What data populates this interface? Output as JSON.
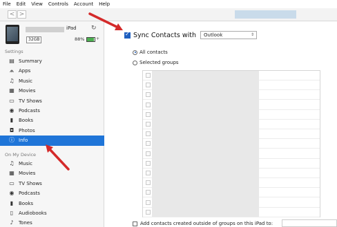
{
  "menu": [
    "File",
    "Edit",
    "View",
    "Controls",
    "Account",
    "Help"
  ],
  "toolbar": {
    "back": "<",
    "forward": ">"
  },
  "device": {
    "name": "iPad",
    "capacity": "32GB",
    "battery": "88%",
    "battery_level": 0.88
  },
  "sidebar": {
    "settings_header": "Settings",
    "settings_items": [
      {
        "label": "Summary",
        "icon": "summary-icon",
        "glyph": "▤"
      },
      {
        "label": "Apps",
        "icon": "apps-icon",
        "glyph": "⩕"
      },
      {
        "label": "Music",
        "icon": "music-icon",
        "glyph": "♫"
      },
      {
        "label": "Movies",
        "icon": "movies-icon",
        "glyph": "▦"
      },
      {
        "label": "TV Shows",
        "icon": "tv-icon",
        "glyph": "▭"
      },
      {
        "label": "Podcasts",
        "icon": "podcast-icon",
        "glyph": "◉"
      },
      {
        "label": "Books",
        "icon": "books-icon",
        "glyph": "▮"
      },
      {
        "label": "Photos",
        "icon": "camera-icon",
        "glyph": "◘"
      },
      {
        "label": "Info",
        "icon": "info-icon",
        "glyph": "ⓘ",
        "active": true
      }
    ],
    "ondevice_header": "On My Device",
    "ondevice_items": [
      {
        "label": "Music",
        "icon": "music-icon",
        "glyph": "♫"
      },
      {
        "label": "Movies",
        "icon": "movies-icon",
        "glyph": "▦"
      },
      {
        "label": "TV Shows",
        "icon": "tv-icon",
        "glyph": "▭"
      },
      {
        "label": "Podcasts",
        "icon": "podcast-icon",
        "glyph": "◉"
      },
      {
        "label": "Books",
        "icon": "books-icon",
        "glyph": "▮"
      },
      {
        "label": "Audiobooks",
        "icon": "audiobook-icon",
        "glyph": "▯"
      },
      {
        "label": "Tones",
        "icon": "bell-icon",
        "glyph": "♪"
      }
    ]
  },
  "main": {
    "sync_label": "Sync Contacts with",
    "sync_source": "Outlook",
    "sync_checked": true,
    "all_contacts": "All contacts",
    "selected_groups": "Selected groups",
    "add_contacts_label": "Add contacts created outside of groups on this iPad to:"
  },
  "colors": {
    "accent": "#1f75d8",
    "arrow": "#d42a2a"
  }
}
